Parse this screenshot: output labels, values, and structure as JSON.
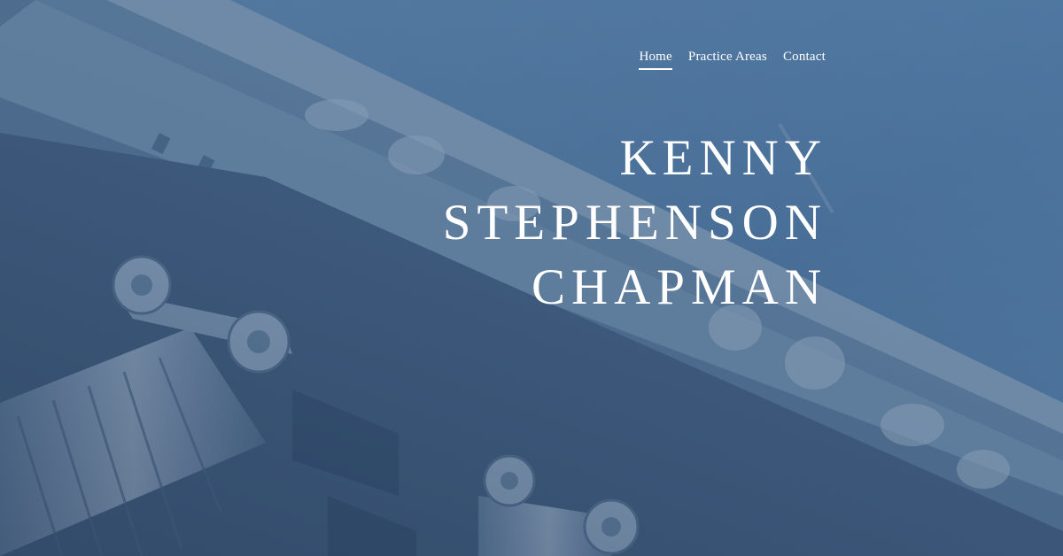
{
  "colors": {
    "sky": "#4d7096",
    "stone": "#6f8aa8",
    "stone_dark": "#2f4a6a",
    "text": "#ffffff"
  },
  "nav": {
    "items": [
      {
        "label": "Home",
        "active": true
      },
      {
        "label": "Practice Areas",
        "active": false
      },
      {
        "label": "Contact",
        "active": false
      }
    ]
  },
  "hero": {
    "title_lines": [
      "KENNY",
      "STEPHENSON",
      "CHAPMAN"
    ]
  }
}
